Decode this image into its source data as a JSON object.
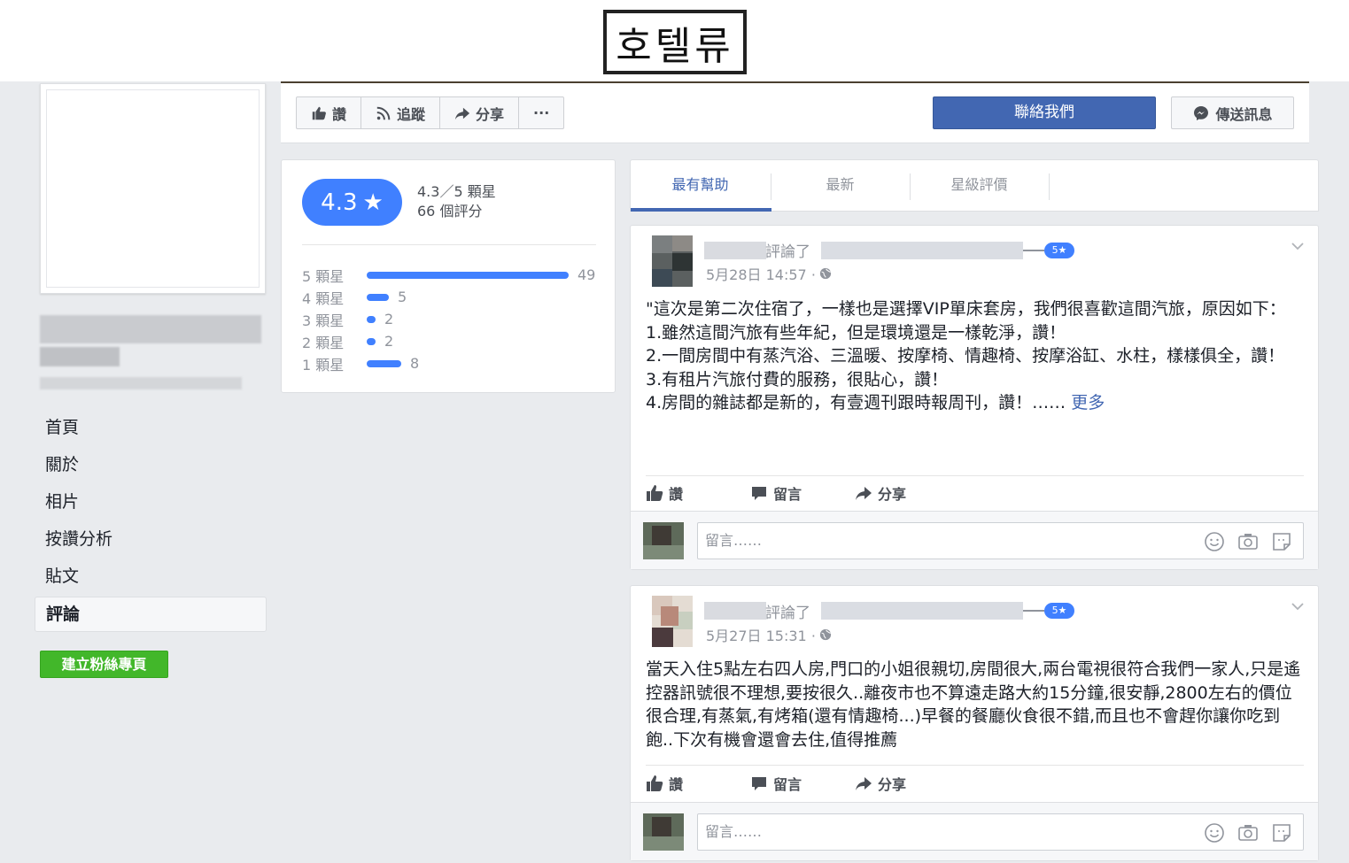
{
  "stamp": {
    "text": "호텔류"
  },
  "actions_bar": {
    "like_label": "讚",
    "follow_label": "追蹤",
    "share_label": "分享",
    "more_label": "···",
    "contact_label": "聯絡我們",
    "message_label": "傳送訊息"
  },
  "sidebar": {
    "items": [
      {
        "label": "首頁"
      },
      {
        "label": "關於"
      },
      {
        "label": "相片"
      },
      {
        "label": "按讚分析"
      },
      {
        "label": "貼文"
      },
      {
        "label": "評論"
      }
    ],
    "create_page_label": "建立粉絲專頁"
  },
  "rating": {
    "pill_value": "4.3",
    "star_glyph": "★",
    "summary_line1": "4.3／5 顆星",
    "summary_line2": "66 個評分",
    "rows": [
      {
        "label": "5 顆星",
        "count": "49",
        "fraction": 1.0
      },
      {
        "label": "4 顆星",
        "count": "5",
        "fraction": 0.11
      },
      {
        "label": "3 顆星",
        "count": "2",
        "fraction": 0.04
      },
      {
        "label": "2 顆星",
        "count": "2",
        "fraction": 0.04
      },
      {
        "label": "1 顆星",
        "count": "8",
        "fraction": 0.17
      }
    ],
    "accent": "#4080ff"
  },
  "tabs": [
    {
      "label": "最有幫助"
    },
    {
      "label": "最新"
    },
    {
      "label": "星級評價"
    }
  ],
  "reviews": [
    {
      "reviewed_label": "評論了",
      "badge": "5★",
      "date": "5月28日 14:57 ·",
      "body": "\"這次是第二次住宿了，一樣也是選擇VIP單床套房，我們很喜歡這間汽旅，原因如下：\n1.雖然這間汽旅有些年紀，但是環境還是一樣乾淨，讚！\n2.一間房間中有蒸汽浴、三溫暖、按摩椅、情趣椅、按摩浴缸、水柱，樣樣俱全，讚！\n3.有租片汽旅付費的服務，很貼心，讚！\n4.房間的雜誌都是新的，有壹週刊跟時報周刊，讚！……",
      "more_label": "更多",
      "like_label": "讚",
      "comment_label": "留言",
      "share_label": "分享",
      "comment_placeholder": "留言……"
    },
    {
      "reviewed_label": "評論了",
      "badge": "5★",
      "date": "5月27日 15:31 ·",
      "body": "當天入住5點左右四人房,門口的小姐很親切,房間很大,兩台電視很符合我們一家人,只是遙控器訊號很不理想,要按很久..離夜市也不算遠走路大約15分鐘,很安靜,2800左右的價位很合理,有蒸氣,有烤箱(還有情趣椅...)早餐的餐廳伙食很不錯,而且也不會趕你讓你吃到飽..下次有機會還會去住,值得推薦",
      "like_label": "讚",
      "comment_label": "留言",
      "share_label": "分享",
      "comment_placeholder": "留言……"
    }
  ],
  "icons": {
    "like": "thumbs-up-icon",
    "follow": "rss-icon",
    "share": "share-arrow-icon",
    "messenger": "messenger-icon",
    "globe": "globe-icon",
    "comment": "speech-bubble-icon",
    "smiley": "smiley-icon",
    "camera": "camera-icon",
    "sticker": "sticker-icon",
    "chevron": "chevron-down-icon"
  },
  "colors": {
    "brand_blue": "#4267b2",
    "rating_blue": "#4080ff",
    "create_green": "#42b72a"
  }
}
